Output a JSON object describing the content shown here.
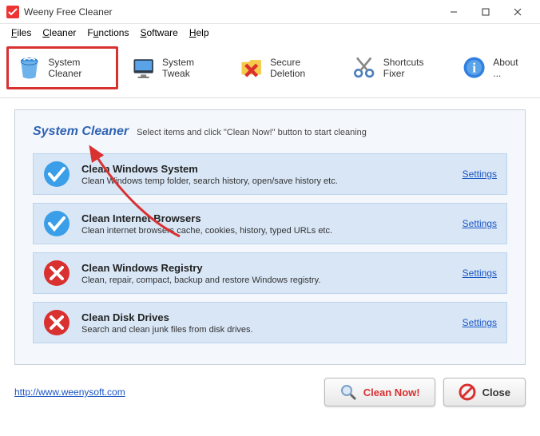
{
  "window": {
    "title": "Weeny Free Cleaner"
  },
  "menu": {
    "files": "Files",
    "cleaner": "Cleaner",
    "functions": "Functions",
    "software": "Software",
    "help": "Help"
  },
  "toolbar": {
    "system_cleaner": "System Cleaner",
    "system_tweak": "System Tweak",
    "secure_deletion": "Secure Deletion",
    "shortcuts_fixer": "Shortcuts Fixer",
    "about": "About ..."
  },
  "panel": {
    "title": "System Cleaner",
    "subtitle": "Select items and click \"Clean Now!\" button to start cleaning"
  },
  "items": [
    {
      "title": "Clean Windows System",
      "desc": "Clean Windows temp folder, search history, open/save history etc.",
      "link": "Settings",
      "checked": true
    },
    {
      "title": "Clean Internet Browsers",
      "desc": "Clean internet browsers cache, cookies, history, typed URLs etc.",
      "link": "Settings",
      "checked": true
    },
    {
      "title": "Clean Windows Registry",
      "desc": "Clean, repair, compact, backup and restore Windows registry.",
      "link": "Settings",
      "checked": false
    },
    {
      "title": "Clean Disk Drives",
      "desc": "Search and clean junk files from disk drives.",
      "link": "Settings",
      "checked": false
    }
  ],
  "footer": {
    "link": "http://www.weenysoft.com",
    "clean": "Clean Now!",
    "close": "Close"
  }
}
